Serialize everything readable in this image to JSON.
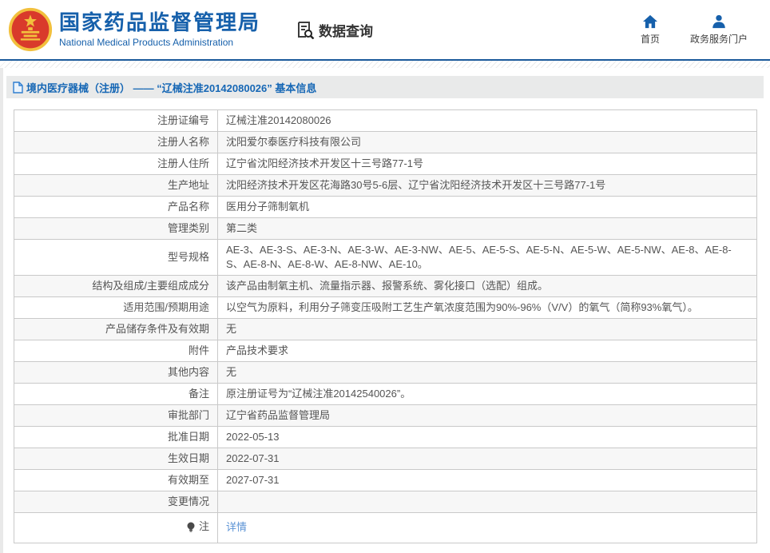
{
  "header": {
    "org_name_cn": "国家药品监督管理局",
    "org_name_en": "National Medical Products Administration",
    "nav_data_query": "数据查询",
    "nav_home": "首页",
    "nav_portal": "政务服务门户"
  },
  "page_title": "境内医疗器械（注册） —— “辽械注准20142080026” 基本信息",
  "colors": {
    "brand_blue": "#1660ab",
    "divider_blue": "#1b5a9b",
    "title_text_blue": "#1667b5",
    "link_blue": "#5b93d5",
    "row_alt_gray": "#f7f7f7",
    "table_border": "#c9c9c9",
    "emblem_red": "#d93a2b",
    "emblem_gold": "#f2c03d"
  },
  "icons": {
    "emblem": "national-emblem-icon",
    "data_query": "document-search-icon",
    "home": "home-icon",
    "portal": "person-icon",
    "title_doc": "document-icon",
    "note": "lightbulb-icon"
  },
  "table": {
    "rows": [
      {
        "label": "注册证编号",
        "value": "辽械注准20142080026"
      },
      {
        "label": "注册人名称",
        "value": "沈阳爱尔泰医疗科技有限公司"
      },
      {
        "label": "注册人住所",
        "value": "辽宁省沈阳经济技术开发区十三号路77-1号"
      },
      {
        "label": "生产地址",
        "value": "沈阳经济技术开发区花海路30号5-6层、辽宁省沈阳经济技术开发区十三号路77-1号"
      },
      {
        "label": "产品名称",
        "value": "医用分子筛制氧机"
      },
      {
        "label": "管理类别",
        "value": "第二类"
      },
      {
        "label": "型号规格",
        "value": "AE-3、AE-3-S、AE-3-N、AE-3-W、AE-3-NW、AE-5、AE-5-S、AE-5-N、AE-5-W、AE-5-NW、AE-8、AE-8-S、AE-8-N、AE-8-W、AE-8-NW、AE-10。"
      },
      {
        "label": "结构及组成/主要组成成分",
        "value": "该产品由制氧主机、流量指示器、报警系统、雾化接口（选配）组成。"
      },
      {
        "label": "适用范围/预期用途",
        "value": "以空气为原料，利用分子筛变压吸附工艺生产氧浓度范围为90%-96%（V/V）的氧气（简称93%氧气）。"
      },
      {
        "label": "产品储存条件及有效期",
        "value": "无"
      },
      {
        "label": "附件",
        "value": "产品技术要求"
      },
      {
        "label": "其他内容",
        "value": "无"
      },
      {
        "label": "备注",
        "value": "原注册证号为“辽械注准20142540026”。"
      },
      {
        "label": "审批部门",
        "value": "辽宁省药品监督管理局"
      },
      {
        "label": "批准日期",
        "value": "2022-05-13"
      },
      {
        "label": "生效日期",
        "value": "2022-07-31"
      },
      {
        "label": "有效期至",
        "value": "2027-07-31"
      },
      {
        "label": "变更情况",
        "value": ""
      },
      {
        "label": "注",
        "value": "详情",
        "is_link": true,
        "has_bulb_icon": true
      }
    ]
  }
}
